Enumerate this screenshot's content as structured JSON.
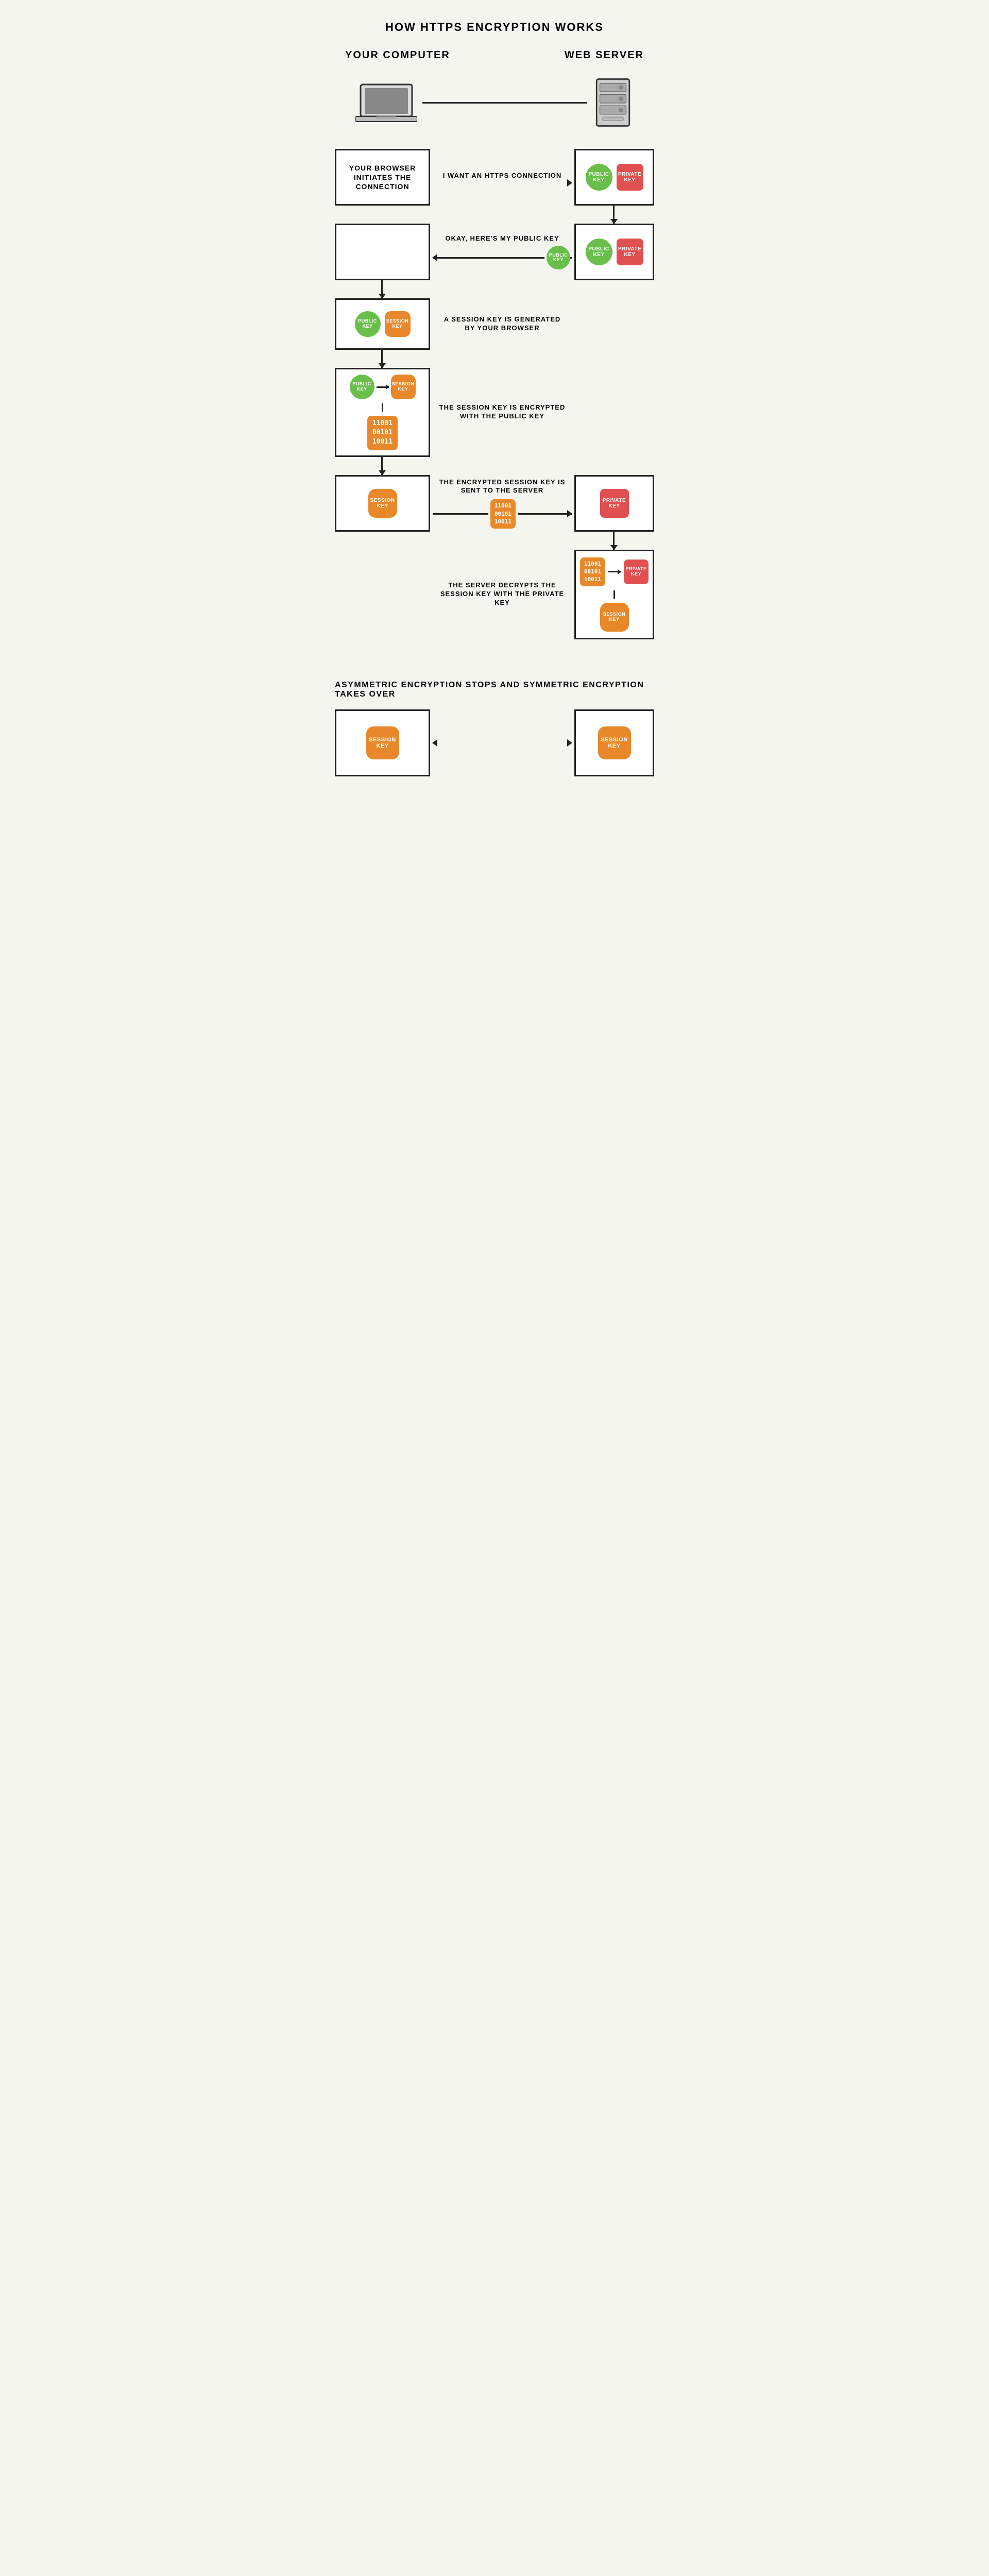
{
  "title": "HOW HTTPS ENCRYPTION WORKS",
  "actors": {
    "computer_label": "YOUR COMPUTER",
    "server_label": "WEB SERVER"
  },
  "steps": [
    {
      "id": "step1",
      "arrow_label": "I WANT AN HTTPS CONNECTION",
      "left_box_text": "YOUR BROWSER INITIATES THE CONNECTION",
      "right_keys": [
        "PUBLIC KEY",
        "PRIVATE KEY"
      ],
      "arrow_direction": "right"
    },
    {
      "id": "step2",
      "arrow_label": "OKAY, HERE'S MY PUBLIC KEY",
      "left_box_empty": true,
      "right_keys": [
        "PUBLIC KEY",
        "PRIVATE KEY"
      ],
      "traveling_key": "PUBLIC KEY",
      "arrow_direction": "left"
    },
    {
      "id": "step3",
      "description": "A SESSION KEY IS GENERATED BY YOUR BROWSER",
      "left_keys": [
        "PUBLIC KEY",
        "SESSION KEY"
      ]
    },
    {
      "id": "step4",
      "description": "THE SESSION KEY IS ENCRYPTED WITH THE PUBLIC KEY",
      "left_box_content": "encrypt",
      "binary": "11001\n00101\n10011"
    },
    {
      "id": "step5",
      "description": "THE ENCRYPTED SESSION KEY IS SENT TO THE SERVER",
      "left_key": "SESSION KEY",
      "binary": "11001\n00101\n10011",
      "right_key": "PRIVATE KEY",
      "arrow_direction": "right"
    },
    {
      "id": "step6",
      "description": "THE SERVER DECRYPTS THE SESSION KEY WITH THE PRIVATE KEY",
      "right_box_content": "decrypt",
      "binary": "11001\n00101\n10011",
      "right_key1": "PRIVATE KEY",
      "right_key2": "SESSION KEY"
    }
  ],
  "symmetric_section": {
    "label": "ASYMMETRIC ENCRYPTION STOPS AND SYMMETRIC ENCRYPTION TAKES OVER",
    "left_key": "SESSION KEY",
    "right_key": "SESSION KEY"
  },
  "keys": {
    "public_key_label": "PUBLIC KEY",
    "private_key_label": "PRIVATE KEY",
    "session_key_label": "SESSION KEY"
  }
}
